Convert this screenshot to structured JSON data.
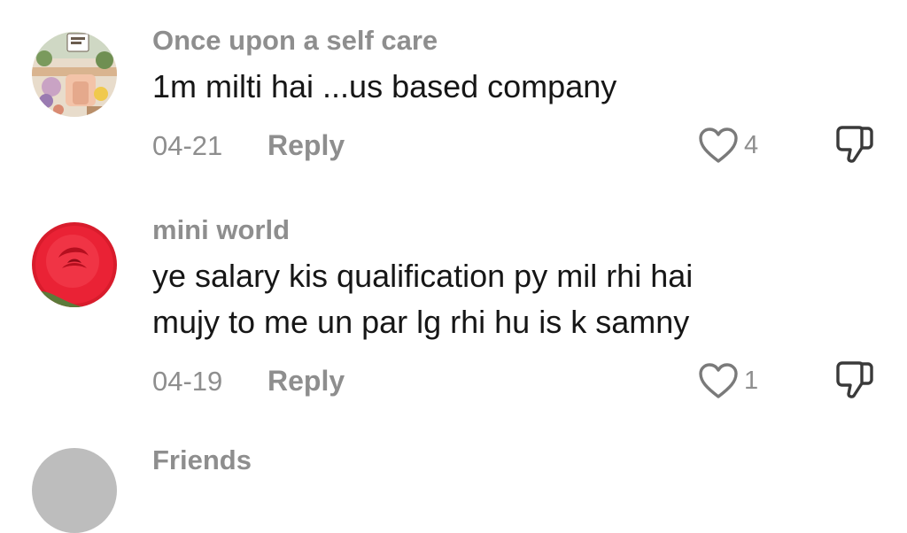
{
  "comments": [
    {
      "username": "Once upon a self care",
      "text_lines": [
        "1m milti hai ...us based company"
      ],
      "date": "04-21",
      "reply_label": "Reply",
      "like_count": "4"
    },
    {
      "username": "mini world",
      "text_lines": [
        "ye salary kis qualification py mil rhi hai",
        "mujy to me un par lg rhi hu is k samny"
      ],
      "date": "04-19",
      "reply_label": "Reply",
      "like_count": "1"
    },
    {
      "username": "Friends"
    }
  ],
  "icons": {
    "like": "heart-outline-icon",
    "dislike": "thumbs-down-outline-icon"
  },
  "colors": {
    "muted_text": "#8e8e8e",
    "body_text": "#161616"
  }
}
